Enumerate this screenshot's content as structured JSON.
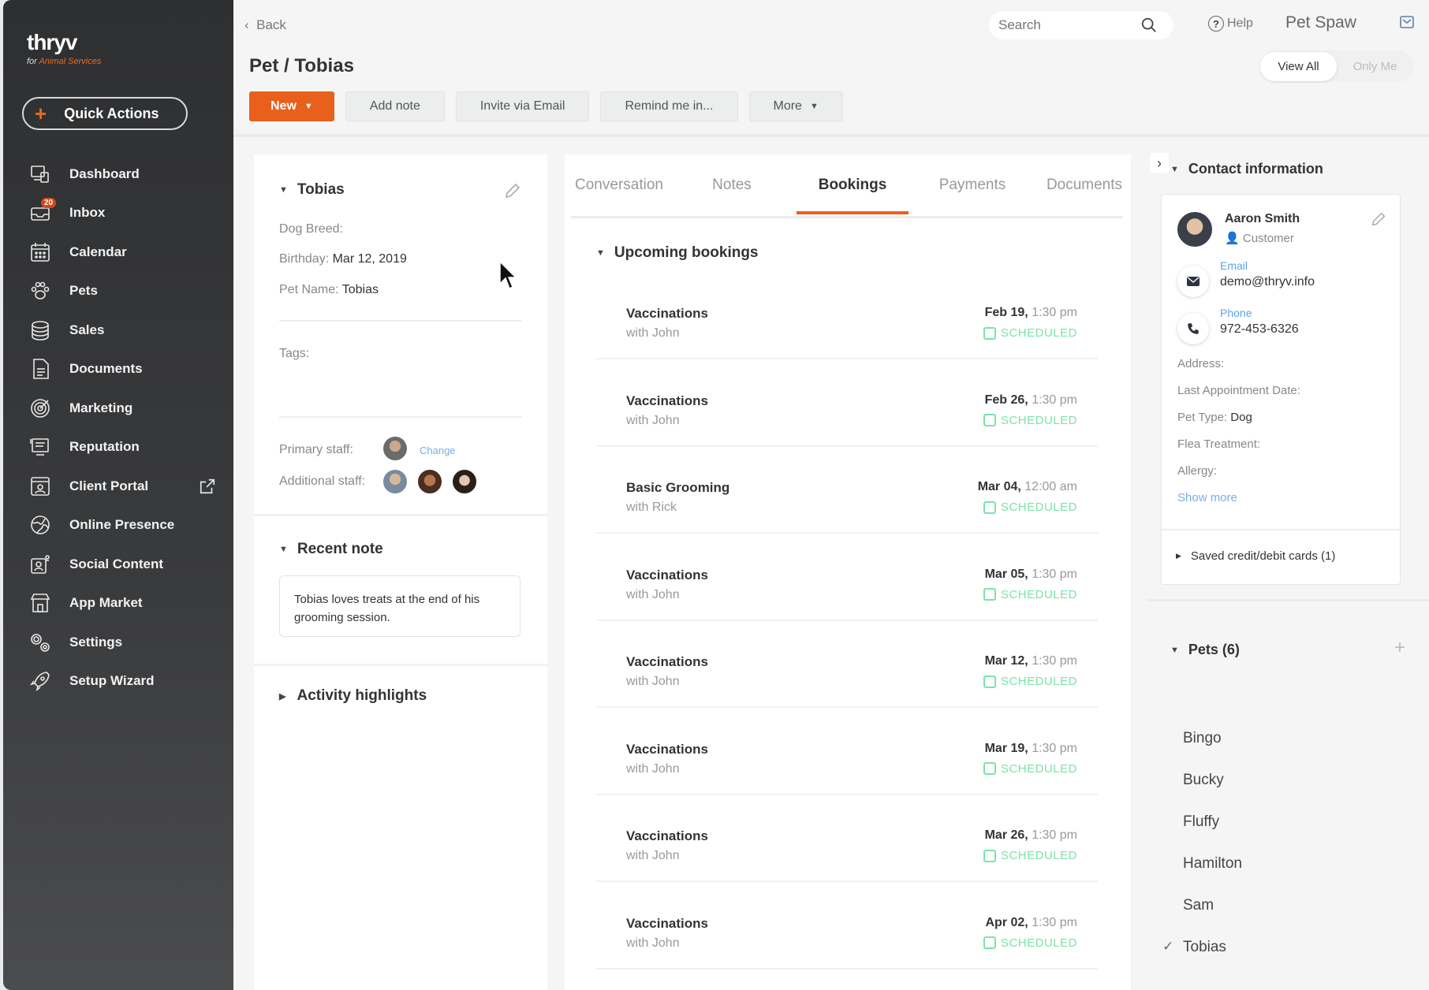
{
  "brand": {
    "name": "thryv",
    "sub_prefix": "for",
    "sub_accent": "Animal Services"
  },
  "quick_actions": {
    "label": "Quick Actions"
  },
  "nav": [
    {
      "label": "Dashboard",
      "icon": "dashboard-icon"
    },
    {
      "label": "Inbox",
      "icon": "inbox-icon",
      "badge": "20"
    },
    {
      "label": "Calendar",
      "icon": "calendar-icon"
    },
    {
      "label": "Pets",
      "icon": "paw-icon"
    },
    {
      "label": "Sales",
      "icon": "coins-icon"
    },
    {
      "label": "Documents",
      "icon": "document-icon"
    },
    {
      "label": "Marketing",
      "icon": "target-icon"
    },
    {
      "label": "Reputation",
      "icon": "reputation-icon"
    },
    {
      "label": "Client Portal",
      "icon": "client-portal-icon",
      "external": true
    },
    {
      "label": "Online Presence",
      "icon": "globe-icon"
    },
    {
      "label": "Social Content",
      "icon": "social-icon"
    },
    {
      "label": "App Market",
      "icon": "store-icon"
    },
    {
      "label": "Settings",
      "icon": "gear-icon"
    },
    {
      "label": "Setup Wizard",
      "icon": "rocket-icon"
    }
  ],
  "topbar": {
    "back": "Back",
    "search_placeholder": "Search",
    "help": "Help",
    "business": "Pet Spaw"
  },
  "page": {
    "title": "Pet / Tobias"
  },
  "view_toggle": {
    "all": "View All",
    "mine": "Only Me"
  },
  "actions": {
    "new": "New",
    "add_note": "Add note",
    "invite": "Invite via Email",
    "remind": "Remind me in...",
    "more": "More"
  },
  "pet": {
    "name": "Tobias",
    "breed_label": "Dog Breed:",
    "breed_value": "",
    "birthday_label": "Birthday:",
    "birthday_value": "Mar 12, 2019",
    "petname_label": "Pet Name:",
    "petname_value": "Tobias",
    "tags_label": "Tags:",
    "primary_staff_label": "Primary staff:",
    "change": "Change",
    "additional_staff_label": "Additional staff:"
  },
  "recent_note": {
    "title": "Recent note",
    "text": "Tobias loves treats at the end of his grooming session."
  },
  "activity": {
    "title": "Activity highlights"
  },
  "tabs": [
    "Conversation",
    "Notes",
    "Bookings",
    "Payments",
    "Documents"
  ],
  "active_tab": "Bookings",
  "upcoming": {
    "title": "Upcoming bookings"
  },
  "bookings": [
    {
      "service": "Vaccinations",
      "with": "with John",
      "date": "Feb 19,",
      "time": "1:30 pm",
      "status": "SCHEDULED"
    },
    {
      "service": "Vaccinations",
      "with": "with John",
      "date": "Feb 26,",
      "time": "1:30 pm",
      "status": "SCHEDULED"
    },
    {
      "service": "Basic Grooming",
      "with": "with Rick",
      "date": "Mar 04,",
      "time": "12:00 am",
      "status": "SCHEDULED"
    },
    {
      "service": "Vaccinations",
      "with": "with John",
      "date": "Mar 05,",
      "time": "1:30 pm",
      "status": "SCHEDULED"
    },
    {
      "service": "Vaccinations",
      "with": "with John",
      "date": "Mar 12,",
      "time": "1:30 pm",
      "status": "SCHEDULED"
    },
    {
      "service": "Vaccinations",
      "with": "with John",
      "date": "Mar 19,",
      "time": "1:30 pm",
      "status": "SCHEDULED"
    },
    {
      "service": "Vaccinations",
      "with": "with John",
      "date": "Mar 26,",
      "time": "1:30 pm",
      "status": "SCHEDULED"
    },
    {
      "service": "Vaccinations",
      "with": "with John",
      "date": "Apr 02,",
      "time": "1:30 pm",
      "status": "SCHEDULED"
    }
  ],
  "contact": {
    "section": "Contact information",
    "name": "Aaron Smith",
    "role": "Customer",
    "email_label": "Email",
    "email": "demo@thryv.info",
    "phone_label": "Phone",
    "phone": "972-453-6326",
    "address_label": "Address:",
    "last_appt_label": "Last Appointment Date:",
    "pet_type_label": "Pet Type:",
    "pet_type": "Dog",
    "flea_label": "Flea Treatment:",
    "allergy_label": "Allergy:",
    "show_more": "Show more",
    "cards": "Saved credit/debit cards (1)"
  },
  "pets": {
    "title": "Pets (6)",
    "items": [
      "Bingo",
      "Bucky",
      "Fluffy",
      "Hamilton",
      "Sam",
      "Tobias"
    ],
    "selected": "Tobias"
  },
  "colors": {
    "accent": "#e8601c",
    "link": "#5aa3e8",
    "scheduled": "#7be3a8"
  }
}
